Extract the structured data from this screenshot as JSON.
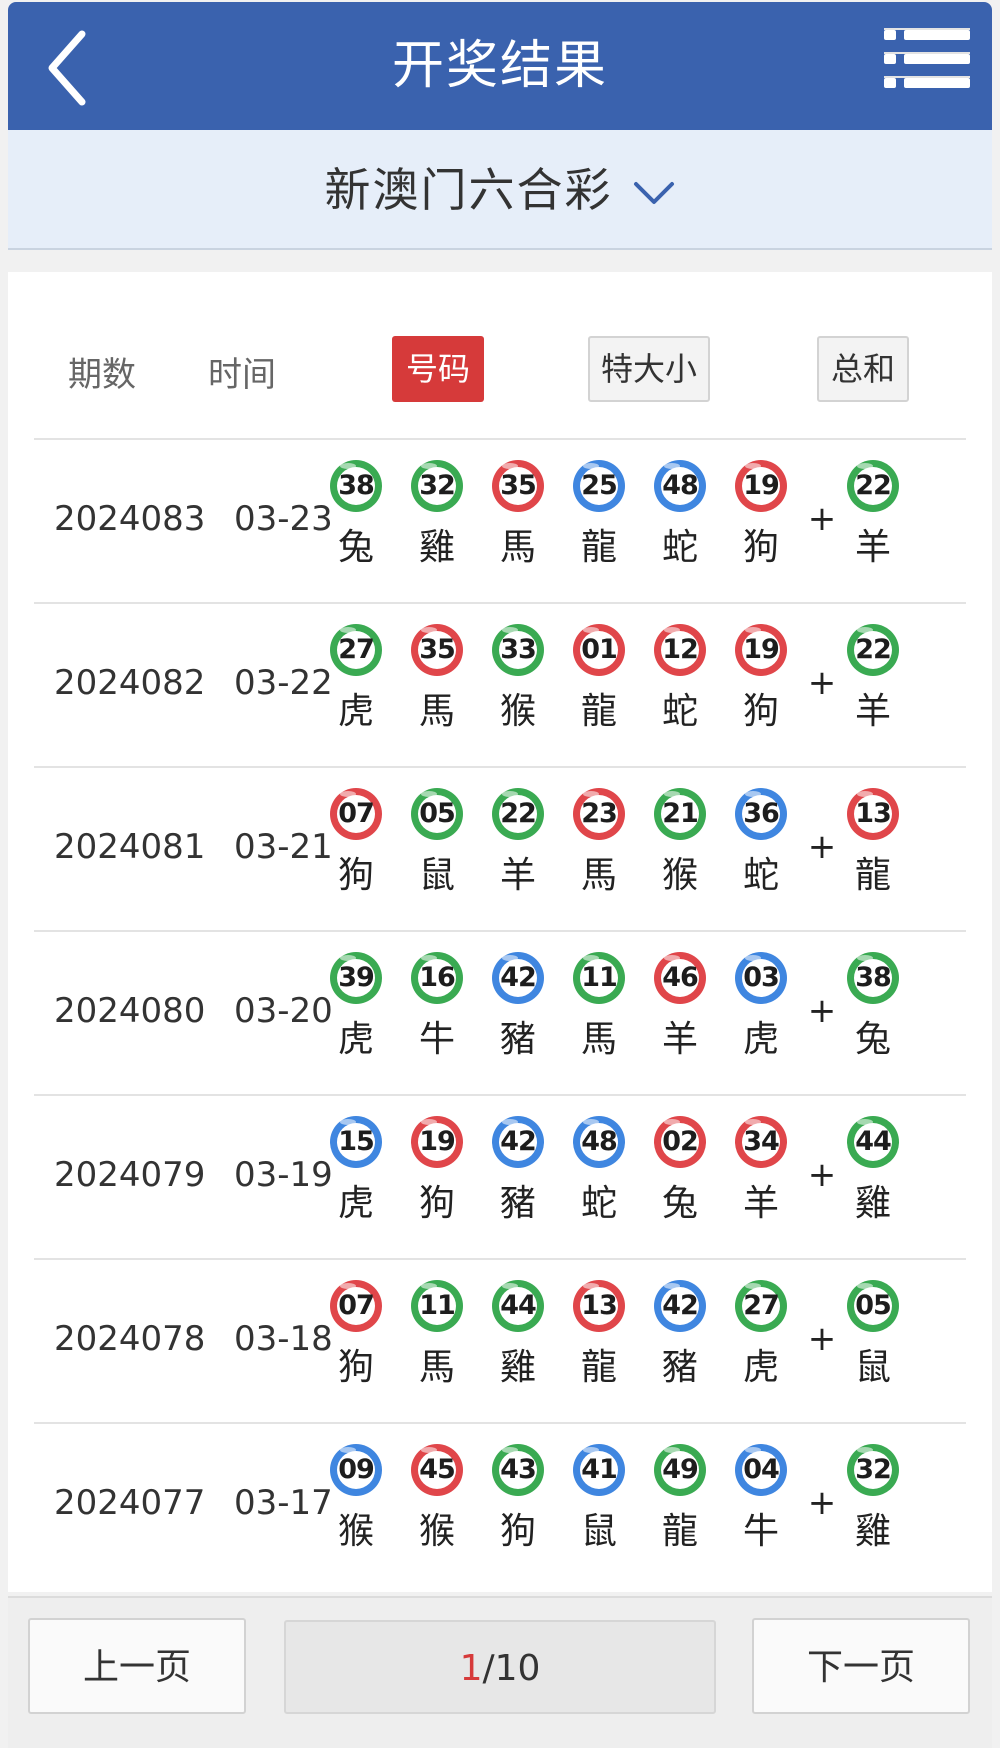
{
  "header": {
    "title": "开奖结果",
    "back_icon": "chevron-left-icon",
    "menu_icon": "list-menu-icon"
  },
  "lottery": {
    "name": "新澳门六合彩",
    "dropdown_icon": "chevron-down-icon"
  },
  "columns": {
    "period": "期数",
    "time": "时间"
  },
  "tabs": [
    {
      "label": "号码",
      "active": true
    },
    {
      "label": "特大小",
      "active": false
    },
    {
      "label": "总和",
      "active": false
    }
  ],
  "colors": {
    "red": "#e0464a",
    "blue": "#3f86e0",
    "green": "#3aaa52",
    "header": "#3a62ae",
    "accent": "#d63a3a"
  },
  "plus_sign": "+",
  "rows": [
    {
      "period": "2024083",
      "date": "03-23",
      "balls": [
        {
          "n": "38",
          "z": "兔",
          "c": "green"
        },
        {
          "n": "32",
          "z": "雞",
          "c": "green"
        },
        {
          "n": "35",
          "z": "馬",
          "c": "red"
        },
        {
          "n": "25",
          "z": "龍",
          "c": "blue"
        },
        {
          "n": "48",
          "z": "蛇",
          "c": "blue"
        },
        {
          "n": "19",
          "z": "狗",
          "c": "red"
        }
      ],
      "special": {
        "n": "22",
        "z": "羊",
        "c": "green"
      }
    },
    {
      "period": "2024082",
      "date": "03-22",
      "balls": [
        {
          "n": "27",
          "z": "虎",
          "c": "green"
        },
        {
          "n": "35",
          "z": "馬",
          "c": "red"
        },
        {
          "n": "33",
          "z": "猴",
          "c": "green"
        },
        {
          "n": "01",
          "z": "龍",
          "c": "red"
        },
        {
          "n": "12",
          "z": "蛇",
          "c": "red"
        },
        {
          "n": "19",
          "z": "狗",
          "c": "red"
        }
      ],
      "special": {
        "n": "22",
        "z": "羊",
        "c": "green"
      }
    },
    {
      "period": "2024081",
      "date": "03-21",
      "balls": [
        {
          "n": "07",
          "z": "狗",
          "c": "red"
        },
        {
          "n": "05",
          "z": "鼠",
          "c": "green"
        },
        {
          "n": "22",
          "z": "羊",
          "c": "green"
        },
        {
          "n": "23",
          "z": "馬",
          "c": "red"
        },
        {
          "n": "21",
          "z": "猴",
          "c": "green"
        },
        {
          "n": "36",
          "z": "蛇",
          "c": "blue"
        }
      ],
      "special": {
        "n": "13",
        "z": "龍",
        "c": "red"
      }
    },
    {
      "period": "2024080",
      "date": "03-20",
      "balls": [
        {
          "n": "39",
          "z": "虎",
          "c": "green"
        },
        {
          "n": "16",
          "z": "牛",
          "c": "green"
        },
        {
          "n": "42",
          "z": "豬",
          "c": "blue"
        },
        {
          "n": "11",
          "z": "馬",
          "c": "green"
        },
        {
          "n": "46",
          "z": "羊",
          "c": "red"
        },
        {
          "n": "03",
          "z": "虎",
          "c": "blue"
        }
      ],
      "special": {
        "n": "38",
        "z": "兔",
        "c": "green"
      }
    },
    {
      "period": "2024079",
      "date": "03-19",
      "balls": [
        {
          "n": "15",
          "z": "虎",
          "c": "blue"
        },
        {
          "n": "19",
          "z": "狗",
          "c": "red"
        },
        {
          "n": "42",
          "z": "豬",
          "c": "blue"
        },
        {
          "n": "48",
          "z": "蛇",
          "c": "blue"
        },
        {
          "n": "02",
          "z": "兔",
          "c": "red"
        },
        {
          "n": "34",
          "z": "羊",
          "c": "red"
        }
      ],
      "special": {
        "n": "44",
        "z": "雞",
        "c": "green"
      }
    },
    {
      "period": "2024078",
      "date": "03-18",
      "balls": [
        {
          "n": "07",
          "z": "狗",
          "c": "red"
        },
        {
          "n": "11",
          "z": "馬",
          "c": "green"
        },
        {
          "n": "44",
          "z": "雞",
          "c": "green"
        },
        {
          "n": "13",
          "z": "龍",
          "c": "red"
        },
        {
          "n": "42",
          "z": "豬",
          "c": "blue"
        },
        {
          "n": "27",
          "z": "虎",
          "c": "green"
        }
      ],
      "special": {
        "n": "05",
        "z": "鼠",
        "c": "green"
      }
    },
    {
      "period": "2024077",
      "date": "03-17",
      "balls": [
        {
          "n": "09",
          "z": "猴",
          "c": "blue"
        },
        {
          "n": "45",
          "z": "猴",
          "c": "red"
        },
        {
          "n": "43",
          "z": "狗",
          "c": "green"
        },
        {
          "n": "41",
          "z": "鼠",
          "c": "blue"
        },
        {
          "n": "49",
          "z": "龍",
          "c": "green"
        },
        {
          "n": "04",
          "z": "牛",
          "c": "blue"
        }
      ],
      "special": {
        "n": "32",
        "z": "雞",
        "c": "green"
      }
    }
  ],
  "pagination": {
    "prev": "上一页",
    "next": "下一页",
    "current": "1",
    "total": "/10"
  }
}
